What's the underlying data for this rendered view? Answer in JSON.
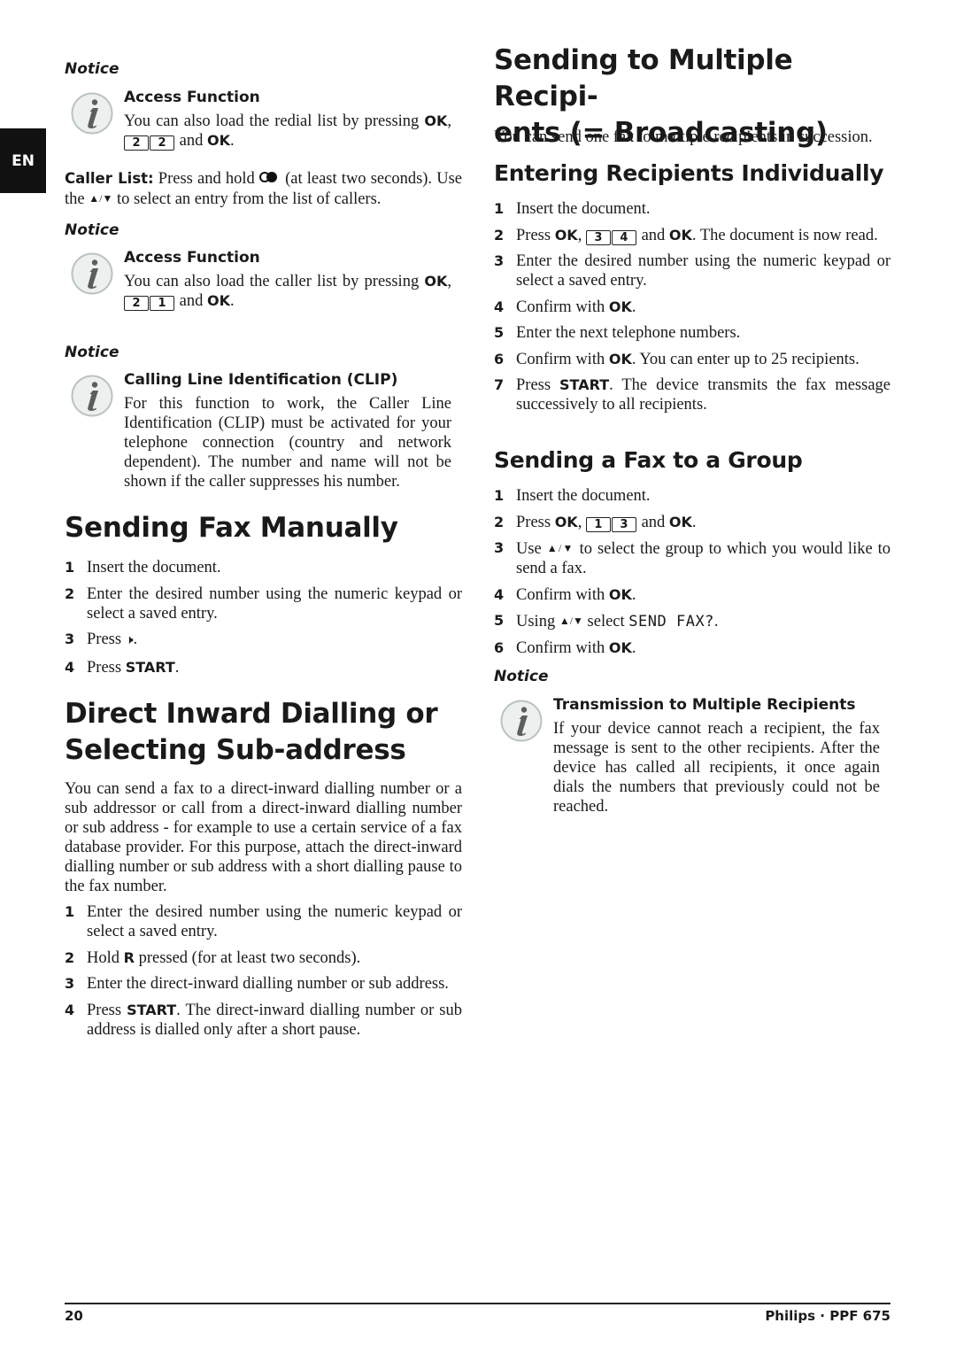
{
  "side_tab": {
    "label": "EN"
  },
  "left": {
    "notice1": {
      "label": "Notice",
      "title": "Access Function",
      "body_pre": "You can also load the redial list by pressing ",
      "bold1": "OK",
      "keys": [
        "2",
        "2"
      ],
      "body_mid": " and ",
      "bold2": "OK",
      "body_end": "."
    },
    "caller_list": {
      "label": "Caller List:",
      "text1": " Press and hold ",
      "icon": "caller-list-button-icon",
      "text2": " (at least two seconds). Use the ",
      "arrows": "▲/▼",
      "text3": " to select an entry from the list of callers."
    },
    "notice2": {
      "label": "Notice",
      "title": "Access Function",
      "body_pre": "You can also load the caller list by pressing ",
      "bold1": "OK",
      "keys": [
        "2",
        "1"
      ],
      "body_mid": " and ",
      "bold2": "OK",
      "body_end": "."
    },
    "notice3": {
      "label": "Notice",
      "title": "Calling Line Identification (CLIP)",
      "body": "For this function to work, the Caller Line Identification (CLIP) must be activated for your telephone connection (country and network dependent). The number and name will not be shown if the caller suppresses his number."
    },
    "manual": {
      "heading": "Sending Fax Manually",
      "steps": [
        {
          "num": "1",
          "text": "Insert the document."
        },
        {
          "num": "2",
          "text": "Enter the desired number using the numeric keypad or select a saved entry."
        },
        {
          "num": "3",
          "pre": "Press ",
          "icon": "speaker-icon",
          "glyph": "🕨",
          "post": "."
        },
        {
          "num": "4",
          "pre": "Press ",
          "bold": "START",
          "post": "."
        }
      ]
    },
    "dial": {
      "heading_line1": "Direct Inward Dialling or",
      "heading_line2": "Selecting Sub-address",
      "intro": "You can send a fax to a direct-inward dialling number or a sub addressor or call from a direct-inward dialling number or sub address - for example to use a certain service of a fax database provider. For this purpose, attach the direct-inward dialling number or sub address with a short dialling pause to the fax number.",
      "steps": [
        {
          "num": "1",
          "text": "Enter the desired number using the numeric keypad or select a saved entry."
        },
        {
          "num": "2",
          "pre": "Hold ",
          "bold": "R",
          "post": " pressed (for at least two seconds)."
        },
        {
          "num": "3",
          "text": "Enter the direct-inward dialling number or sub address."
        },
        {
          "num": "4",
          "pre": "Press ",
          "bold": "START",
          "post": ". The direct-inward dialling number or sub address is dialled only after a short pause."
        }
      ]
    }
  },
  "right": {
    "broadcast": {
      "heading_line1": "Sending to Multiple Recipi-",
      "heading_line2": "ents (= Broadcasting)",
      "intro": "You can send one fax to multiple recipients in succession."
    },
    "individual": {
      "heading": "Entering Recipients Individually",
      "steps": [
        {
          "num": "1",
          "text": "Insert the document."
        },
        {
          "num": "2",
          "pre": "Press ",
          "bold1": "OK",
          "sep": ", ",
          "keys": [
            "3",
            "4"
          ],
          "mid": " and ",
          "bold2": "OK",
          "post": ". The document is now read."
        },
        {
          "num": "3",
          "text": "Enter the desired number using the numeric keypad or select a saved entry."
        },
        {
          "num": "4",
          "pre": "Confirm with ",
          "bold": "OK",
          "post": "."
        },
        {
          "num": "5",
          "text": "Enter the next telephone numbers."
        },
        {
          "num": "6",
          "pre": "Confirm with ",
          "bold": "OK",
          "post": ". You can enter up to 25 recipients."
        },
        {
          "num": "7",
          "pre": "Press ",
          "bold": "START",
          "post": ". The device transmits the fax message successively to all recipients."
        }
      ]
    },
    "group": {
      "heading": "Sending a Fax to a Group",
      "steps": [
        {
          "num": "1",
          "text": "Insert the document."
        },
        {
          "num": "2",
          "pre": "Press ",
          "bold1": "OK",
          "sep": ", ",
          "keys": [
            "1",
            "3"
          ],
          "mid": " and ",
          "bold2": "OK",
          "post": "."
        },
        {
          "num": "3",
          "pre": "Use ",
          "arrows": "▲/▼",
          "post": " to select the group to which you would like to send a fax."
        },
        {
          "num": "4",
          "pre": "Confirm with ",
          "bold": "OK",
          "post": "."
        },
        {
          "num": "5",
          "pre": "Using ",
          "arrows": "▲/▼",
          "mid": " select ",
          "lcd": "SEND FAX?",
          "post": "."
        },
        {
          "num": "6",
          "pre": "Confirm with ",
          "bold": "OK",
          "post": "."
        }
      ]
    },
    "notice": {
      "label": "Notice",
      "title": "Transmission to Multiple Recipients",
      "body": "If your device cannot reach a recipient, the fax message is sent to the other recipients. After the device has called all recipients, it once again dials the numbers that previously could not be reached."
    }
  },
  "footer": {
    "page_number": "20",
    "brand": "Philips · PPF 675"
  }
}
